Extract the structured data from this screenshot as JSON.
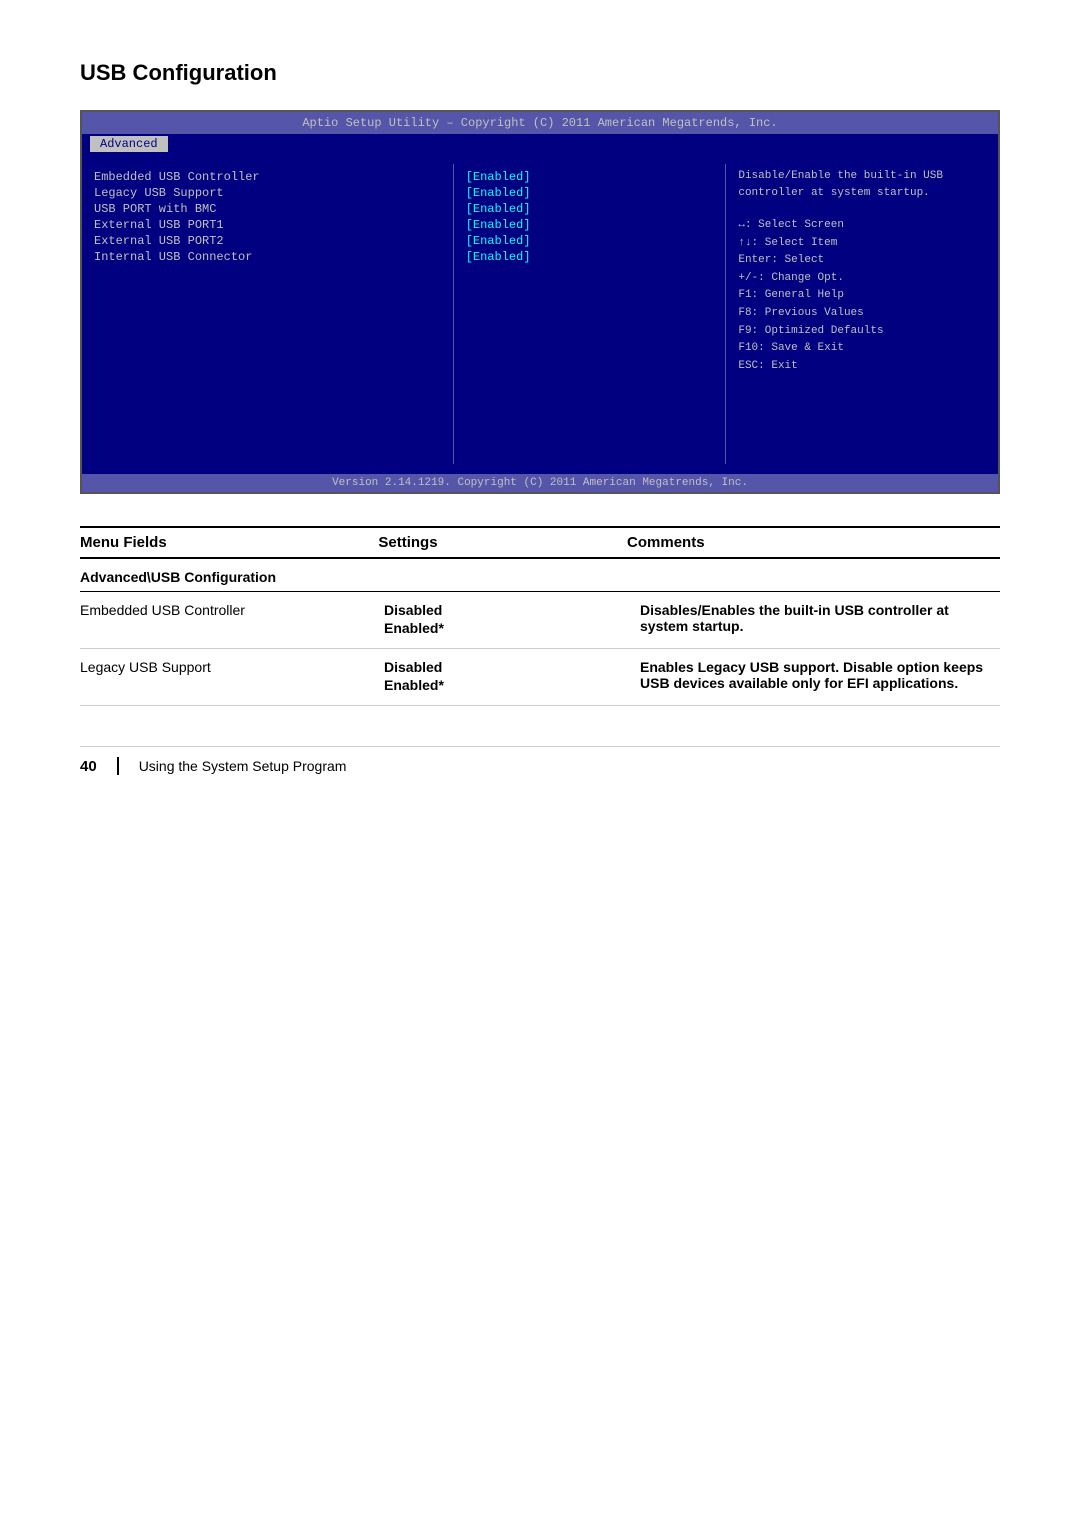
{
  "page": {
    "title": "USB Configuration",
    "footer_page_number": "40",
    "footer_text": "Using the System Setup Program"
  },
  "bios": {
    "header": "Aptio Setup Utility – Copyright (C) 2011 American Megatrends, Inc.",
    "tab_label": "Advanced",
    "footer": "Version 2.14.1219. Copyright (C) 2011 American Megatrends, Inc.",
    "items": [
      {
        "label": "Embedded USB Controller",
        "value": "[Enabled]"
      },
      {
        "label": "Legacy USB Support",
        "value": "[Enabled]"
      },
      {
        "label": "USB PORT with BMC",
        "value": "[Enabled]"
      },
      {
        "label": "External USB PORT1",
        "value": "[Enabled]"
      },
      {
        "label": "External USB PORT2",
        "value": "[Enabled]"
      },
      {
        "label": "Internal USB Connector",
        "value": "[Enabled]"
      }
    ],
    "help_text": "Disable/Enable the built-in USB controller at system startup.",
    "key_lines": [
      "↔: Select Screen",
      "↑↓: Select Item",
      "Enter: Select",
      "+/-: Change Opt.",
      "F1: General Help",
      "F8: Previous Values",
      "F9: Optimized Defaults",
      "F10: Save & Exit",
      "ESC: Exit"
    ]
  },
  "table": {
    "headers": {
      "menu_fields": "Menu Fields",
      "settings": "Settings",
      "comments": "Comments"
    },
    "section_header": "Advanced\\USB Configuration",
    "rows": [
      {
        "menu_field": "Embedded USB Controller",
        "settings": [
          {
            "text": "Disabled",
            "bold": false
          },
          {
            "text": "Enabled*",
            "bold": true
          }
        ],
        "comments": "Disables/Enables the built-in USB controller at system startup."
      },
      {
        "menu_field": "Legacy USB Support",
        "settings": [
          {
            "text": "Disabled",
            "bold": false
          },
          {
            "text": "Enabled*",
            "bold": true
          }
        ],
        "comments": "Enables Legacy USB support. Disable option keeps USB devices available only for EFI applications."
      }
    ]
  }
}
